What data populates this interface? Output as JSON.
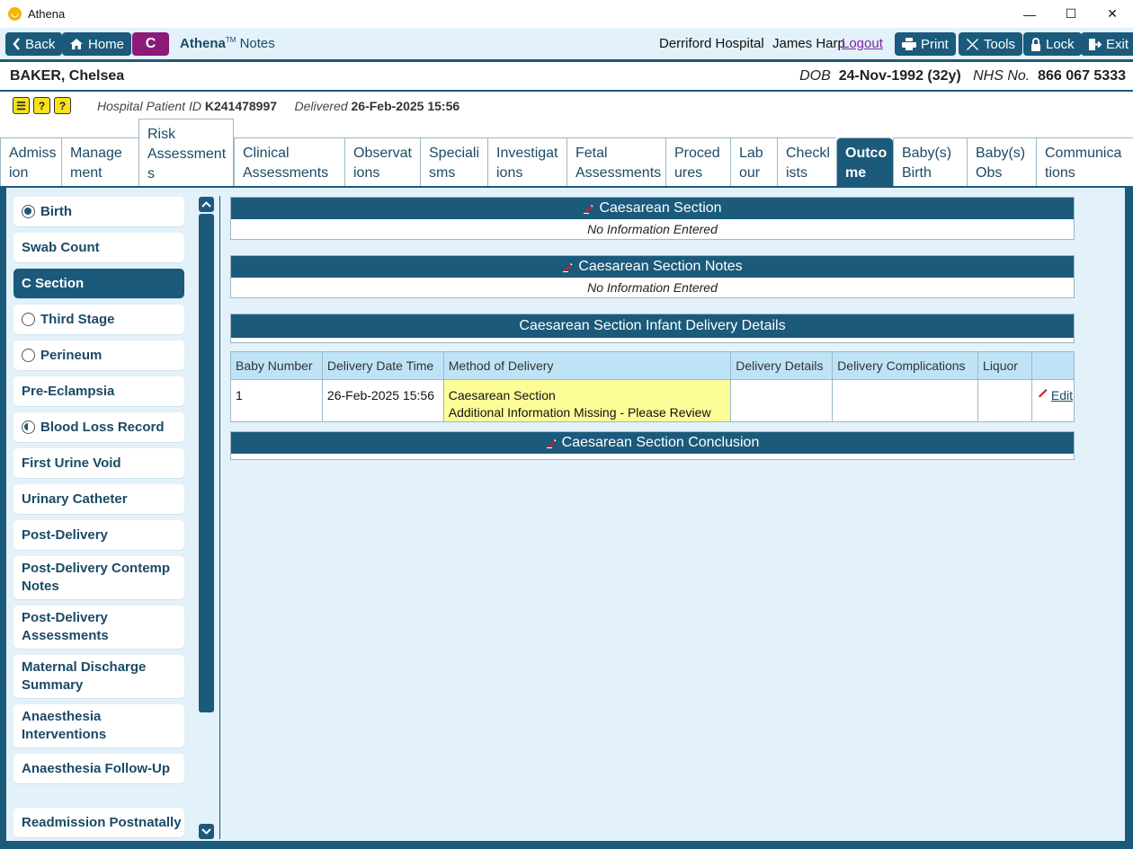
{
  "window": {
    "title": "Athena",
    "minimize": "—",
    "maximize": "☐",
    "close": "✕"
  },
  "toolbar": {
    "back_label": "Back",
    "home_label": "Home",
    "c_label": "C",
    "brand_name": "Athena",
    "brand_tm": "TM",
    "brand_module": "Notes",
    "hospital": "Derriford Hospital",
    "user": "James Harp",
    "logout_label": "Logout",
    "print_label": "Print",
    "tools_label": "Tools",
    "lock_label": "Lock",
    "exit_label": "Exit"
  },
  "patient": {
    "name": "BAKER, Chelsea",
    "dob_label": "DOB",
    "dob": "24-Nov-1992 (32y)",
    "nhs_label": "NHS No.",
    "nhs": "866 067 5333",
    "hospital_id_label": "Hospital Patient ID",
    "hospital_id": "K241478997",
    "delivered_label": "Delivered",
    "delivered": "26-Feb-2025 15:56"
  },
  "tabs": [
    {
      "line1": "Admiss",
      "line2": "ion"
    },
    {
      "line1": "Manage",
      "line2": "ment"
    },
    {
      "line1": "Risk",
      "line2": "Assessment",
      "line3": "s"
    },
    {
      "line1": "Clinical",
      "line2": "Assessments"
    },
    {
      "line1": "Observat",
      "line2": "ions"
    },
    {
      "line1": "Speciali",
      "line2": "sms"
    },
    {
      "line1": "Investigat",
      "line2": "ions"
    },
    {
      "line1": "Fetal",
      "line2": "Assessments"
    },
    {
      "line1": "Proced",
      "line2": "ures"
    },
    {
      "line1": "Lab",
      "line2": "our"
    },
    {
      "line1": "Checkl",
      "line2": "ists"
    },
    {
      "line1": "Outco",
      "line2": "me"
    },
    {
      "line1": "Baby(s)",
      "line2": "Birth"
    },
    {
      "line1": "Baby(s)",
      "line2": "Obs"
    },
    {
      "line1": "Communica",
      "line2": "tions"
    }
  ],
  "sidebar": {
    "items": [
      {
        "label": "Birth",
        "status": "full"
      },
      {
        "label": "Swab Count",
        "status": ""
      },
      {
        "label": "C Section",
        "status": ""
      },
      {
        "label": "Third Stage",
        "status": "empty"
      },
      {
        "label": "Perineum",
        "status": "empty"
      },
      {
        "label": "Pre-Eclampsia",
        "status": ""
      },
      {
        "label": "Blood Loss Record",
        "status": "half"
      },
      {
        "label": "First Urine Void",
        "status": ""
      },
      {
        "label": "Urinary Catheter",
        "status": ""
      },
      {
        "label": "Post-Delivery",
        "status": ""
      },
      {
        "label": "Post-Delivery Contemp Notes",
        "status": ""
      },
      {
        "label": "Post-Delivery Assessments",
        "status": ""
      },
      {
        "label": "Maternal Discharge Summary",
        "status": ""
      },
      {
        "label": "Anaesthesia Interventions",
        "status": ""
      },
      {
        "label": "Anaesthesia Follow-Up",
        "status": ""
      },
      {
        "label": "Readmission Postnatally",
        "status": ""
      }
    ]
  },
  "sections": {
    "caesarean": {
      "title": "Caesarean Section",
      "body": "No Information Entered"
    },
    "notes": {
      "title": "Caesarean Section Notes",
      "body": "No Information Entered"
    },
    "infant": {
      "title": "Caesarean Section Infant Delivery Details"
    },
    "conclusion": {
      "title": "Caesarean Section Conclusion"
    }
  },
  "delivery_table": {
    "headers": [
      "Baby Number",
      "Delivery Date Time",
      "Method of Delivery",
      "Delivery Details",
      "Delivery Complications",
      "Liquor",
      ""
    ],
    "rows": [
      {
        "baby_number": "1",
        "date_time": "26-Feb-2025 15:56",
        "method": "Caesarean Section",
        "method_note": "Additional Information Missing - Please Review",
        "details": "",
        "complications": "",
        "liquor": "",
        "edit_label": "Edit"
      }
    ]
  },
  "colors": {
    "primary": "#1b5a7a",
    "panel": "#e2f1fa",
    "header_row": "#bfe3f6",
    "warning": "#fdfd98",
    "c_badge": "#8b1a78",
    "alert": "#f7e21b"
  }
}
